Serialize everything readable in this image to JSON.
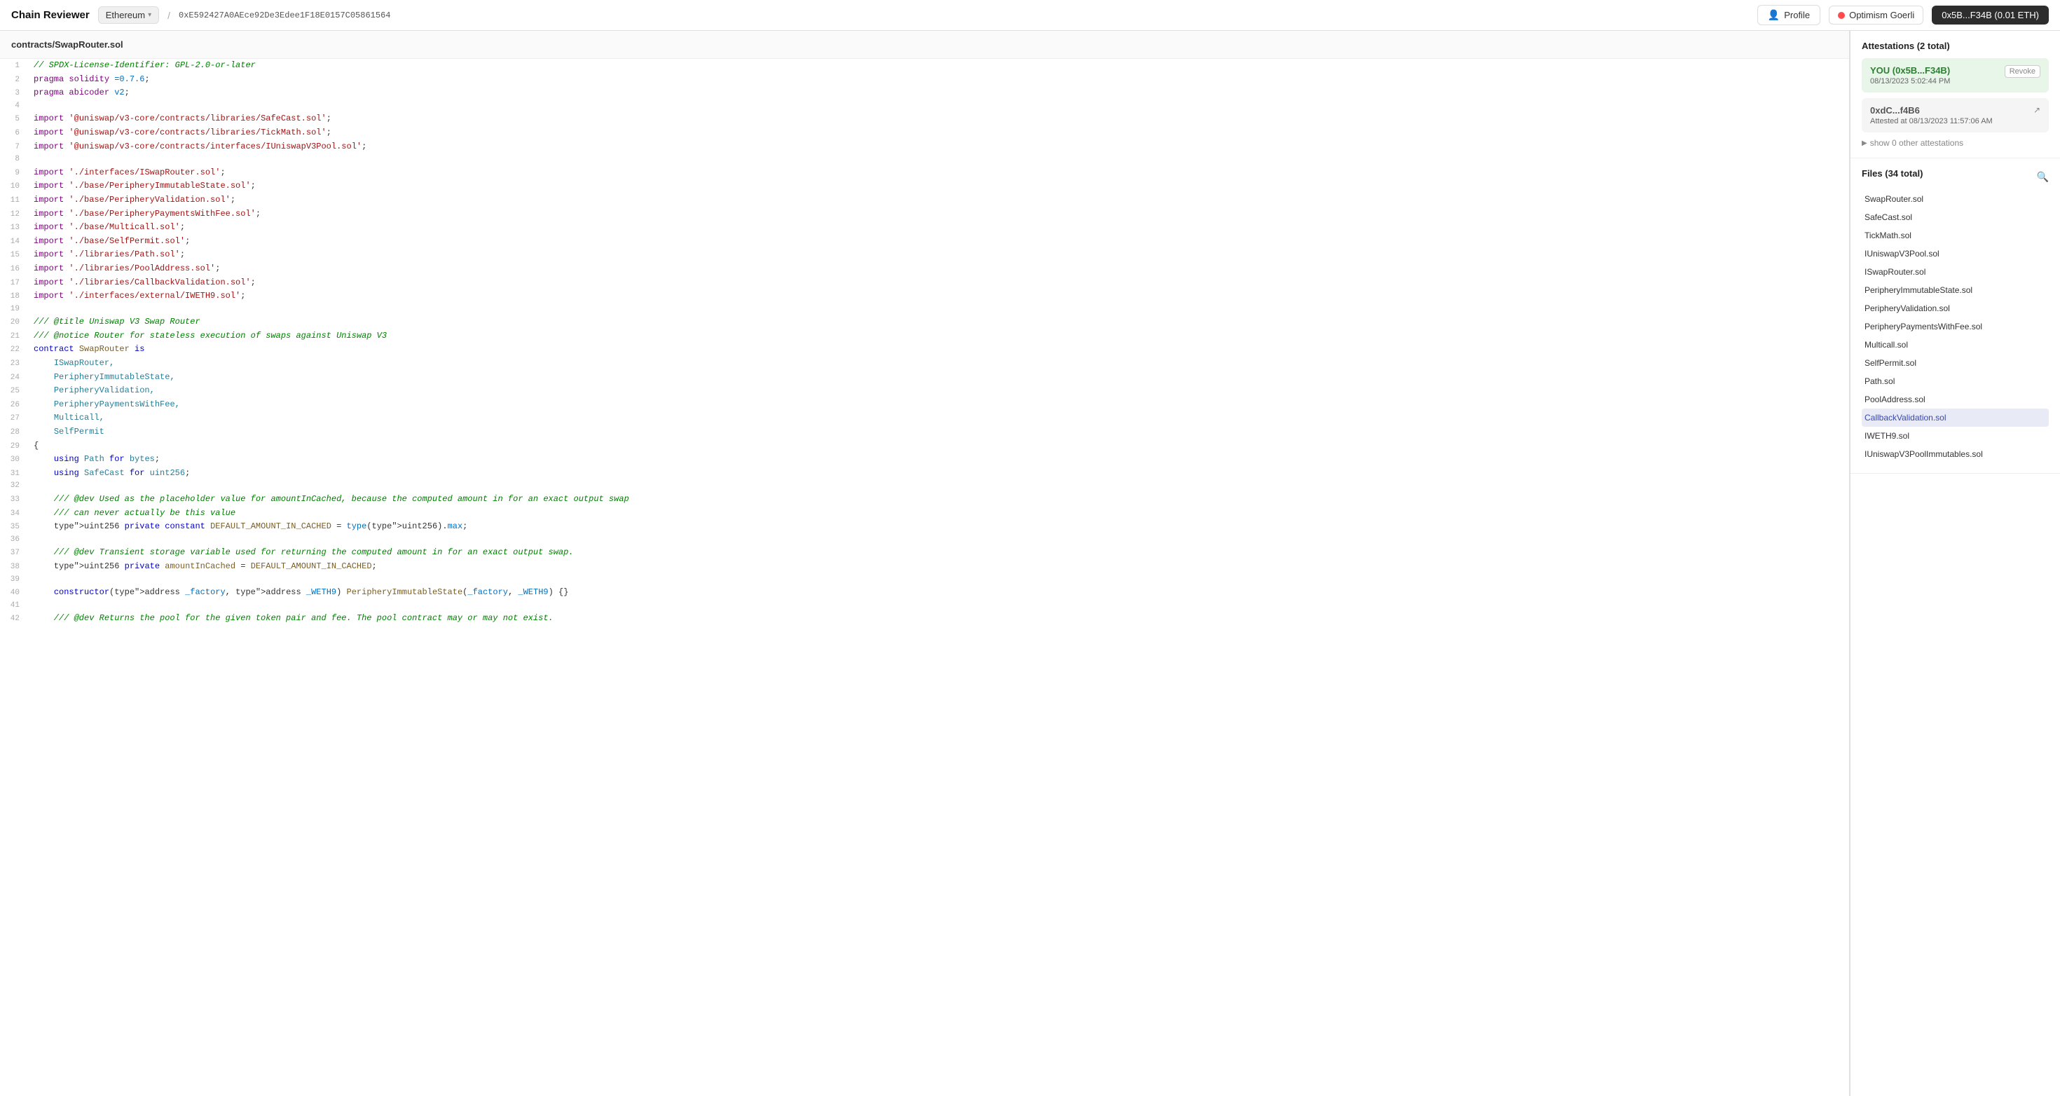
{
  "header": {
    "brand": "Chain Reviewer",
    "network": "Ethereum",
    "address": "0xE592427A0AEce92De3Edee1F18E0157C05861564",
    "profile_label": "Profile",
    "network_badge": "Optimism Goerli",
    "wallet_label": "0x5B...F34B (0.01 ETH)"
  },
  "file_header": "contracts/SwapRouter.sol",
  "attestations": {
    "title": "Attestations (2 total)",
    "items": [
      {
        "addr": "YOU (0x5B...F34B)",
        "date": "08/13/2023 5:02:44 PM",
        "action": "Revoke",
        "color": "green"
      },
      {
        "addr": "0xdC...f4B6",
        "date": "Attested at 08/13/2023 11:57:06 AM",
        "action": "link",
        "color": "gray"
      }
    ],
    "show_others": "show 0 other attestations"
  },
  "files": {
    "title": "Files (34 total)",
    "items": [
      "SwapRouter.sol",
      "SafeCast.sol",
      "TickMath.sol",
      "IUniswapV3Pool.sol",
      "ISwapRouter.sol",
      "PeripheryImmutableState.sol",
      "PeripheryValidation.sol",
      "PeripheryPaymentsWithFee.sol",
      "Multicall.sol",
      "SelfPermit.sol",
      "Path.sol",
      "PoolAddress.sol",
      "CallbackValidation.sol",
      "IWETH9.sol",
      "IUniswapV3PoolImmutables.sol"
    ],
    "active": "CallbackValidation.sol"
  },
  "code": {
    "lines": [
      {
        "n": 1,
        "text": "// SPDX-License-Identifier: GPL-2.0-or-later",
        "type": "comment"
      },
      {
        "n": 2,
        "text": "pragma solidity =0.7.6;",
        "type": "pragma"
      },
      {
        "n": 3,
        "text": "pragma abicoder v2;",
        "type": "pragma"
      },
      {
        "n": 4,
        "text": "",
        "type": "blank"
      },
      {
        "n": 5,
        "text": "import '@uniswap/v3-core/contracts/libraries/SafeCast.sol';",
        "type": "import"
      },
      {
        "n": 6,
        "text": "import '@uniswap/v3-core/contracts/libraries/TickMath.sol';",
        "type": "import"
      },
      {
        "n": 7,
        "text": "import '@uniswap/v3-core/contracts/interfaces/IUniswapV3Pool.sol';",
        "type": "import"
      },
      {
        "n": 8,
        "text": "",
        "type": "blank"
      },
      {
        "n": 9,
        "text": "import './interfaces/ISwapRouter.sol';",
        "type": "import"
      },
      {
        "n": 10,
        "text": "import './base/PeripheryImmutableState.sol';",
        "type": "import"
      },
      {
        "n": 11,
        "text": "import './base/PeripheryValidation.sol';",
        "type": "import"
      },
      {
        "n": 12,
        "text": "import './base/PeripheryPaymentsWithFee.sol';",
        "type": "import"
      },
      {
        "n": 13,
        "text": "import './base/Multicall.sol';",
        "type": "import"
      },
      {
        "n": 14,
        "text": "import './base/SelfPermit.sol';",
        "type": "import"
      },
      {
        "n": 15,
        "text": "import './libraries/Path.sol';",
        "type": "import"
      },
      {
        "n": 16,
        "text": "import './libraries/PoolAddress.sol';",
        "type": "import"
      },
      {
        "n": 17,
        "text": "import './libraries/CallbackValidation.sol';",
        "type": "import"
      },
      {
        "n": 18,
        "text": "import './interfaces/external/IWETH9.sol';",
        "type": "import"
      },
      {
        "n": 19,
        "text": "",
        "type": "blank"
      },
      {
        "n": 20,
        "text": "/// @title Uniswap V3 Swap Router",
        "type": "comment"
      },
      {
        "n": 21,
        "text": "/// @notice Router for stateless execution of swaps against Uniswap V3",
        "type": "comment"
      },
      {
        "n": 22,
        "text": "contract SwapRouter is",
        "type": "contract"
      },
      {
        "n": 23,
        "text": "    ISwapRouter,",
        "type": "inherit"
      },
      {
        "n": 24,
        "text": "    PeripheryImmutableState,",
        "type": "inherit"
      },
      {
        "n": 25,
        "text": "    PeripheryValidation,",
        "type": "inherit"
      },
      {
        "n": 26,
        "text": "    PeripheryPaymentsWithFee,",
        "type": "inherit"
      },
      {
        "n": 27,
        "text": "    Multicall,",
        "type": "inherit"
      },
      {
        "n": 28,
        "text": "    SelfPermit",
        "type": "inherit"
      },
      {
        "n": 29,
        "text": "{",
        "type": "brace"
      },
      {
        "n": 30,
        "text": "    using Path for bytes;",
        "type": "using"
      },
      {
        "n": 31,
        "text": "    using SafeCast for uint256;",
        "type": "using"
      },
      {
        "n": 32,
        "text": "",
        "type": "blank"
      },
      {
        "n": 33,
        "text": "    /// @dev Used as the placeholder value for amountInCached, because the computed amount in for an exact output swap",
        "type": "comment"
      },
      {
        "n": 34,
        "text": "    /// can never actually be this value",
        "type": "comment"
      },
      {
        "n": 35,
        "text": "    uint256 private constant DEFAULT_AMOUNT_IN_CACHED = type(uint256).max;",
        "type": "code"
      },
      {
        "n": 36,
        "text": "",
        "type": "blank"
      },
      {
        "n": 37,
        "text": "    /// @dev Transient storage variable used for returning the computed amount in for an exact output swap.",
        "type": "comment"
      },
      {
        "n": 38,
        "text": "    uint256 private amountInCached = DEFAULT_AMOUNT_IN_CACHED;",
        "type": "code"
      },
      {
        "n": 39,
        "text": "",
        "type": "blank"
      },
      {
        "n": 40,
        "text": "    constructor(address _factory, address _WETH9) PeripheryImmutableState(_factory, _WETH9) {}",
        "type": "code"
      },
      {
        "n": 41,
        "text": "",
        "type": "blank"
      },
      {
        "n": 42,
        "text": "    /// @dev Returns the pool for the given token pair and fee. The pool contract may or may not exist.",
        "type": "comment"
      }
    ]
  }
}
